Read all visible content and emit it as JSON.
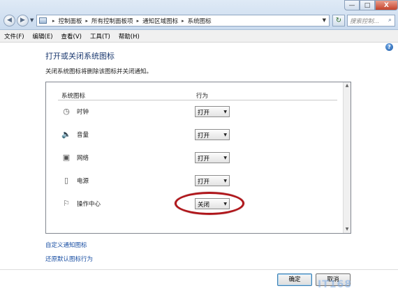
{
  "window": {
    "controls": {
      "minimize": "—",
      "maximize": "□",
      "close": "X"
    }
  },
  "address_bar": {
    "breadcrumbs": [
      "控制面板",
      "所有控制面板项",
      "通知区域图标",
      "系统图标"
    ]
  },
  "search": {
    "placeholder": "搜索控制..."
  },
  "menu": {
    "items": [
      "文件(F)",
      "编辑(E)",
      "查看(V)",
      "工具(T)",
      "帮助(H)"
    ]
  },
  "page": {
    "title": "打开或关闭系统图标",
    "description": "关闭系统图标将删除该图标并关闭通知。"
  },
  "table": {
    "headers": {
      "icon": "系统图标",
      "behavior": "行为"
    },
    "rows": [
      {
        "icon": "clock-icon",
        "label": "时钟",
        "value": "打开"
      },
      {
        "icon": "volume-icon",
        "label": "音量",
        "value": "打开"
      },
      {
        "icon": "network-icon",
        "label": "网络",
        "value": "打开"
      },
      {
        "icon": "power-icon",
        "label": "电源",
        "value": "打开"
      },
      {
        "icon": "action-center-icon",
        "label": "操作中心",
        "value": "关闭"
      }
    ]
  },
  "links": {
    "customize": "自定义通知图标",
    "restore": "还原默认图标行为"
  },
  "buttons": {
    "ok": "确定",
    "cancel": "取消"
  },
  "watermark": "IT168",
  "colors": {
    "highlight": "#b0171c",
    "link": "#1a4fa3",
    "title": "#1c3a70"
  }
}
